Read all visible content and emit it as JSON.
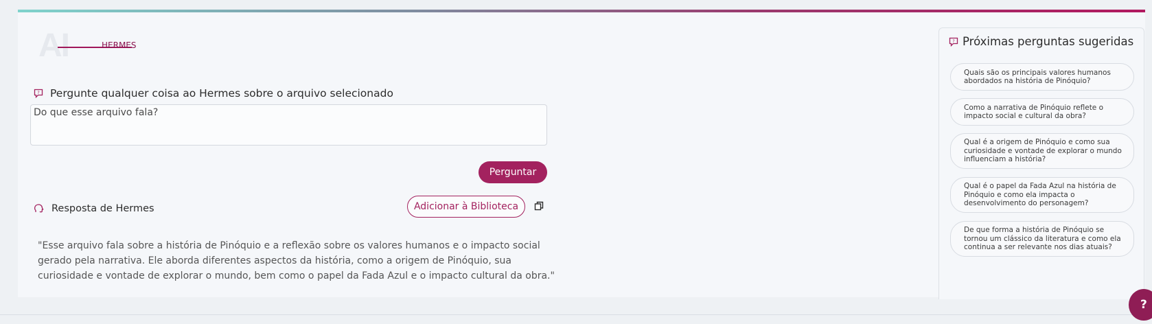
{
  "logo": {
    "mark": "AI",
    "label": "HERMES"
  },
  "ask": {
    "heading": "Pergunte qualquer coisa ao Hermes sobre o arquivo selecionado",
    "input_value": "Do que esse arquivo fala?",
    "button_label": "Perguntar"
  },
  "answer": {
    "heading": "Resposta de Hermes",
    "library_button_label": "Adicionar à Biblioteca",
    "text": "\"Esse arquivo fala sobre a história de Pinóquio e a reflexão sobre os valores humanos e o impacto social gerado pela narrativa. Ele aborda diferentes aspectos da história, como a origem de Pinóquio, sua curiosidade e vontade de explorar o mundo, bem como o papel da Fada Azul e o impacto cultural da obra.\""
  },
  "suggestions": {
    "heading": "Próximas perguntas sugeridas",
    "items": [
      {
        "label": "Quais são os principais valores humanos abordados na história de Pinóquio?"
      },
      {
        "label": "Como a narrativa de Pinóquio reflete o impacto social e cultural da obra?"
      },
      {
        "label": "Qual é a origem de Pinóquio e como sua curiosidade e vontade de explorar o mundo influenciam a história?"
      },
      {
        "label": "Qual é o papel da Fada Azul na história de Pinóquio e como ela impacta o desenvolvimento do personagem?"
      },
      {
        "label": "De que forma a história de Pinóquio se tornou um clássico da literatura e como ela continua a ser relevante nos dias atuais?"
      }
    ]
  },
  "help": {
    "label": "?"
  },
  "icons": {
    "ask": "question-chat-icon",
    "answer": "speech-head-icon",
    "copy": "copy-icon",
    "suggest": "question-chat-icon"
  },
  "colors": {
    "accent": "#a3225f",
    "accent_dark": "#8f1d55",
    "gradient_start": "#7fd3cc",
    "gradient_end": "#b1195f"
  }
}
